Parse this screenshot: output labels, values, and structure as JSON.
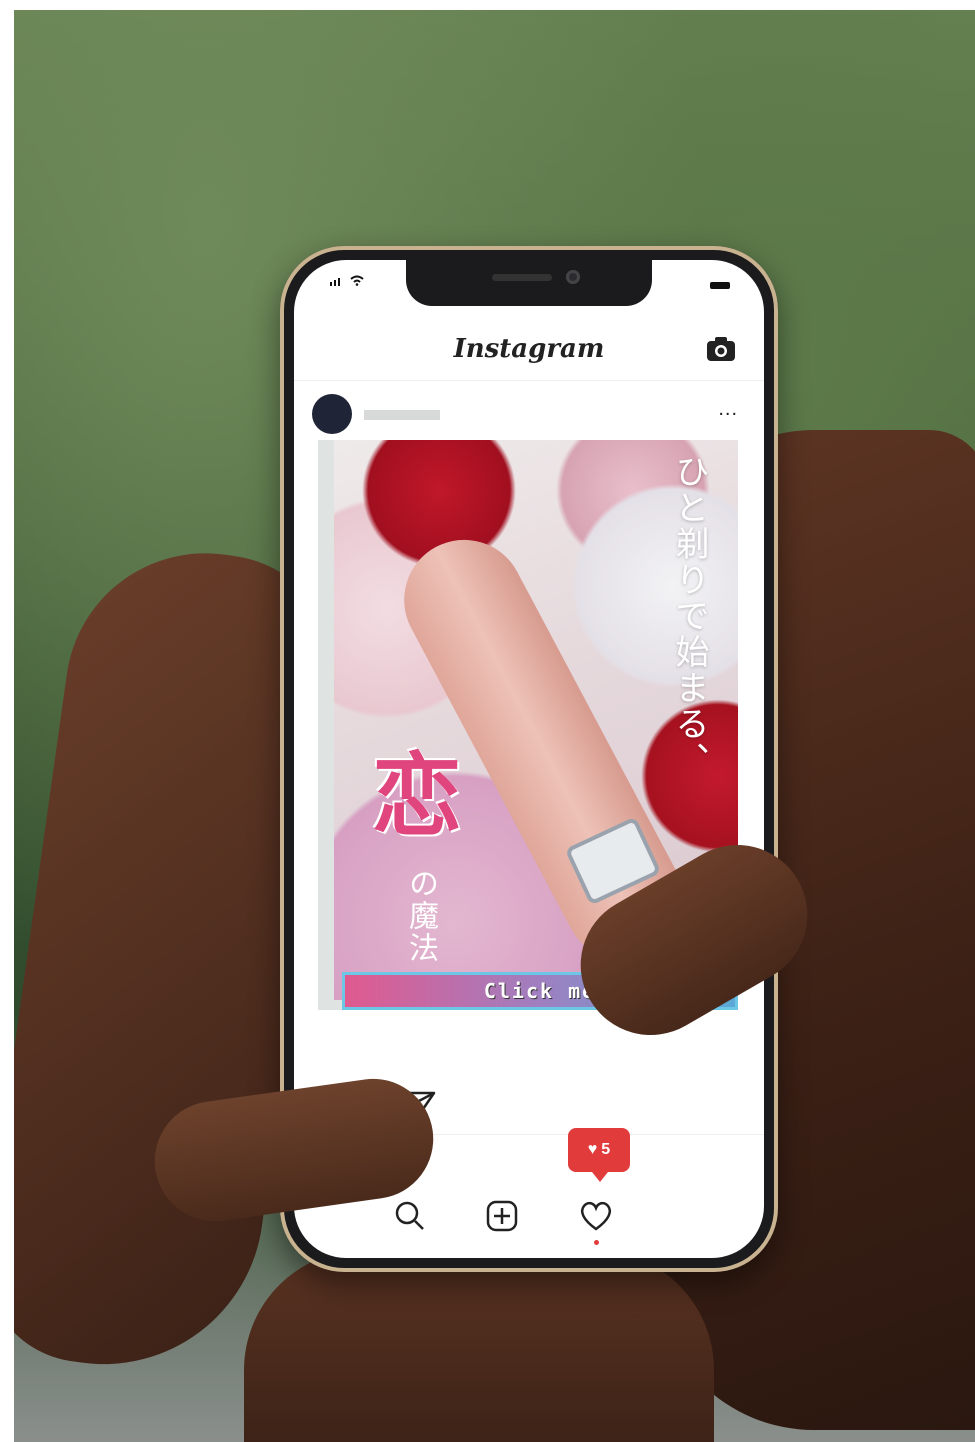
{
  "instagram": {
    "app_title": "Instagram",
    "more_label": "...",
    "post": {
      "vertical_tagline": "ひと剃りで始まる、",
      "headline_char": "恋",
      "headline_suffix": "の魔法",
      "cta_label": "Click me"
    },
    "likes_count": "5",
    "icons": {
      "header": [
        "camera-icon"
      ],
      "actions": [
        "heart-icon",
        "comment-icon",
        "share-icon"
      ],
      "nav": [
        "search-icon",
        "add-icon",
        "heart-icon"
      ]
    }
  },
  "colors": {
    "accent_pink": "#e0457d",
    "like_badge": "#e23b3b",
    "cta_blue": "#5aa9d6"
  }
}
